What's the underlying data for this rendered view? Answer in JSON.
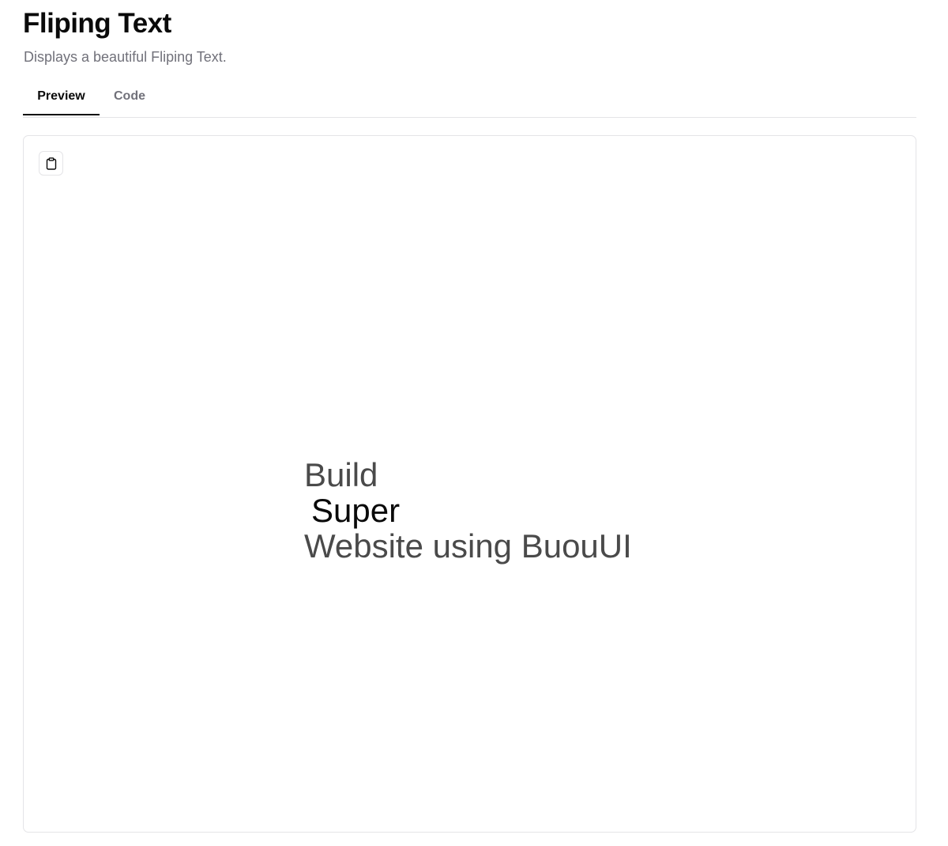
{
  "header": {
    "title": "Fliping Text",
    "subtitle": "Displays a beautiful Fliping Text."
  },
  "tabs": [
    {
      "label": "Preview",
      "active": true
    },
    {
      "label": "Code",
      "active": false
    }
  ],
  "preview": {
    "copy_icon": "clipboard-icon",
    "text_before": "Build",
    "flip_word": "Super",
    "text_after": "Website using BuouUI"
  }
}
